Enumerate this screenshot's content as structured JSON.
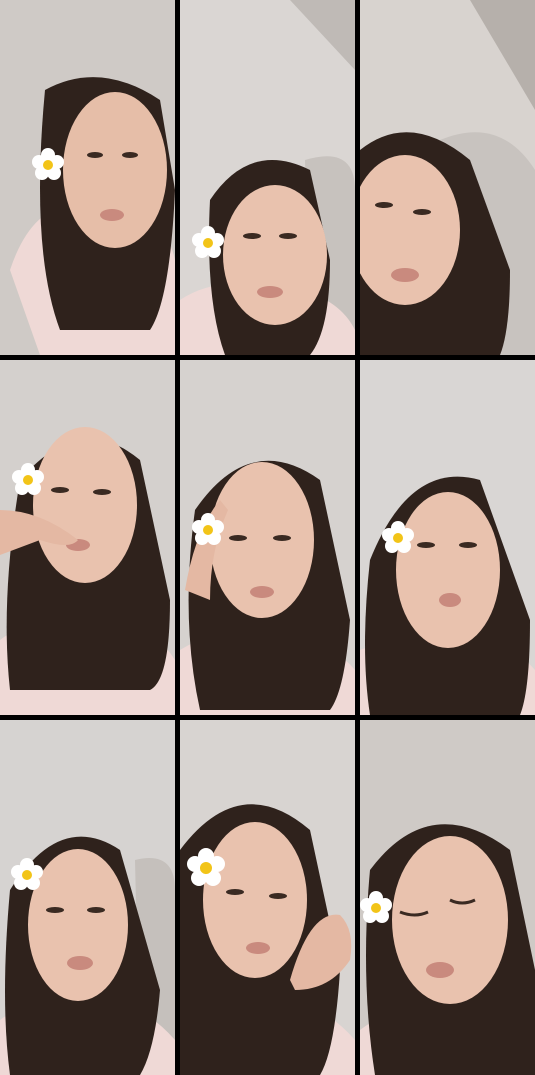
{
  "collage": {
    "rows": 3,
    "columns": 3,
    "frames": [
      {
        "subject": "woman-with-flower-filter",
        "flower": true
      },
      {
        "subject": "woman-with-flower-filter",
        "flower": true
      },
      {
        "subject": "woman-leaning-on-sofa",
        "flower": false
      },
      {
        "subject": "woman-hand-to-mouth",
        "flower": true
      },
      {
        "subject": "woman-hand-to-forehead",
        "flower": true
      },
      {
        "subject": "woman-talking",
        "flower": true
      },
      {
        "subject": "woman-talking",
        "flower": true
      },
      {
        "subject": "woman-hand-on-cheek",
        "flower": true
      },
      {
        "subject": "woman-eyes-closed",
        "flower": true
      }
    ]
  },
  "colors": {
    "divider": "#000000",
    "wall": "#d9d6d3",
    "hair": "#2f221c",
    "skin": "#e9c2ae",
    "pajama": "#efd9d6",
    "flower_petal": "#ffffff",
    "flower_center": "#f2c418"
  }
}
